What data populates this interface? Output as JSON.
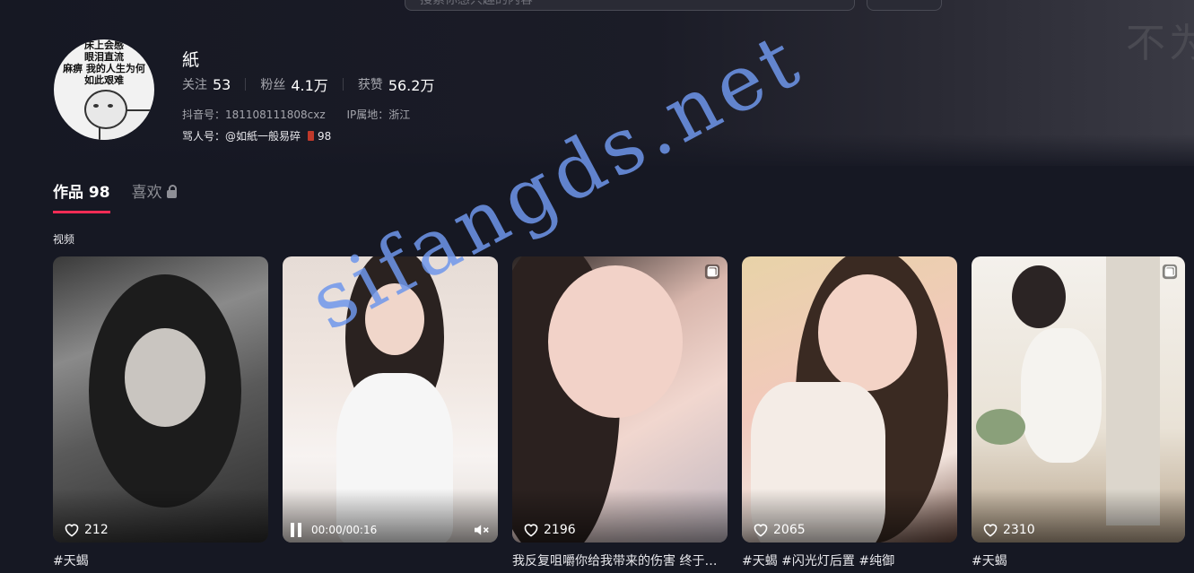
{
  "search": {
    "placeholder": "搜索你感兴趣的内容"
  },
  "banner": {
    "text": "不为"
  },
  "avatar": {
    "lines": [
      "床上会感",
      "眼泪直流",
      "麻痹 我的人生为何",
      "如此艰难"
    ]
  },
  "profile": {
    "name": "紙",
    "stats": [
      {
        "label": "关注",
        "value": "53"
      },
      {
        "label": "粉丝",
        "value": "4.1万"
      },
      {
        "label": "获赞",
        "value": "56.2万"
      }
    ],
    "douyin_id": "抖音号：181108111808cxz",
    "ip": "IP属地：浙江",
    "byline_prefix": "骂人号：@如紙一般易碎",
    "byline_count": "98"
  },
  "tabs": [
    {
      "label": "作品 98"
    },
    {
      "label": "喜欢"
    }
  ],
  "section_label": "视频",
  "cards": [
    {
      "likes": "212",
      "caption": "#天蝎"
    },
    {
      "time": "00:00/00:16",
      "caption": ""
    },
    {
      "likes": "2196",
      "caption": "我反复咀嚼你给我带来的伤害 终于…"
    },
    {
      "likes": "2065",
      "caption": "#天蝎 #闪光灯后置 #纯御"
    },
    {
      "likes": "2310",
      "caption": "#天蝎"
    }
  ],
  "watermark": "sifangds.net",
  "colors": {
    "accent": "#fe2c55",
    "background": "#161823",
    "watermark": "#6e96eb"
  }
}
